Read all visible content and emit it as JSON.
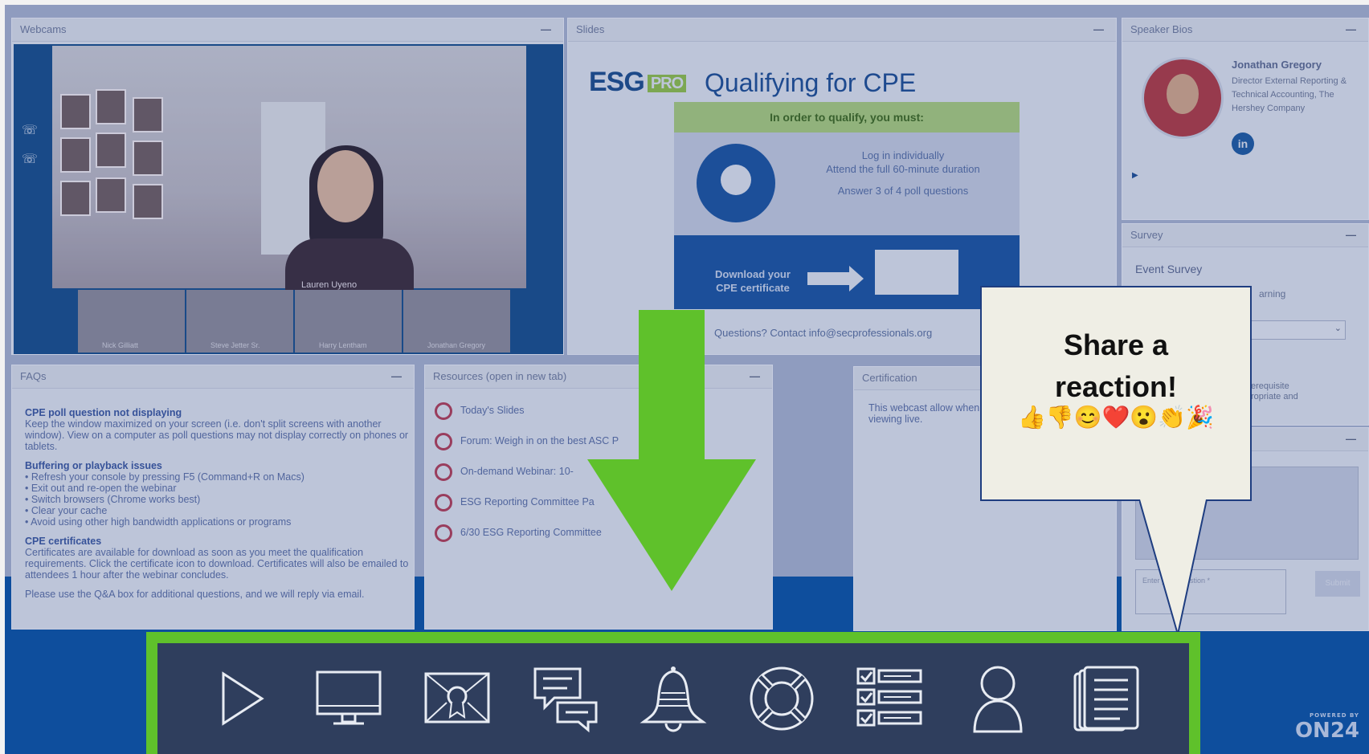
{
  "panels": {
    "webcams": {
      "title": "Webcams"
    },
    "slides": {
      "title": "Slides"
    },
    "bios": {
      "title": "Speaker Bios"
    },
    "survey": {
      "title": "Survey"
    },
    "faqs": {
      "title": "FAQs"
    },
    "resources": {
      "title": "Resources (open in new tab)"
    },
    "certification": {
      "title": "Certification"
    },
    "minimize_glyph": "—"
  },
  "webcam": {
    "main_name": "Lauren Uyeno",
    "participants": [
      "Nick Gilliatt",
      "Steve Jetter Sr.",
      "Harry Lentham",
      "Jonathan Gregory"
    ]
  },
  "slide": {
    "logo_text": "ESG",
    "logo_badge": "PRO",
    "title": "Qualifying for CPE",
    "requirement_header": "In order to qualify, you must:",
    "requirements": [
      "Log in individually",
      "Attend the full 60-minute duration",
      "Answer 3 of 4 poll questions"
    ],
    "download_label": "Download your CPE certificate",
    "contact": "Questions? Contact info@secprofessionals.org"
  },
  "speaker": {
    "name": "Jonathan Gregory",
    "role": "Director External Reporting & Technical Accounting, The Hershey Company",
    "linkedin_label": "in"
  },
  "survey": {
    "title": "Event Survey",
    "partial_1": "arning",
    "partial_2": "erequisite\nropriate and"
  },
  "qa": {
    "input_placeholder": "Enter your question *",
    "submit_label": "Submit"
  },
  "faqs": {
    "sections": [
      {
        "heading": "CPE poll question not displaying",
        "body": "Keep the window maximized on your screen (i.e. don't split screens with another window). View on a computer as poll questions may not display correctly on phones or tablets."
      },
      {
        "heading": "Buffering or playback issues",
        "body": "• Refresh your console by pressing F5 (Command+R on Macs)\n• Exit out and re-open the webinar\n• Switch browsers (Chrome works best)\n• Clear your cache\n• Avoid using other high bandwidth applications or programs"
      },
      {
        "heading": "CPE certificates",
        "body": "Certificates are available for download as soon as you meet the qualification requirements. Click the certificate icon to download. Certificates will also be emailed to attendees 1 hour after the webinar concludes."
      },
      {
        "heading": "",
        "body": "Please use the Q&A box for additional questions, and we will reply via email."
      }
    ]
  },
  "resources": {
    "items": [
      "Today's Slides",
      "Forum: Weigh in on the best ASC P",
      "On-demand Webinar: 10-",
      "ESG Reporting Committee Pa",
      "6/30 ESG Reporting Committee"
    ]
  },
  "certification": {
    "body": "This webcast allow when viewing live."
  },
  "callout": {
    "title_line1": "Share a",
    "title_line2": "reaction!",
    "emojis": "👍👎😊❤️😮👏🎉"
  },
  "toolbar": {
    "icons": [
      "play-icon",
      "monitor-icon",
      "certificate-icon",
      "chat-icon",
      "bell-icon",
      "lifebuoy-icon",
      "checklist-icon",
      "person-icon",
      "document-icon"
    ]
  },
  "branding": {
    "powered_by": "POWERED BY",
    "logo": "ON24"
  },
  "colors": {
    "accent_green": "#5fc12b",
    "toolbar_bg": "#2f3e5d",
    "brand_blue": "#0e4e9d"
  }
}
